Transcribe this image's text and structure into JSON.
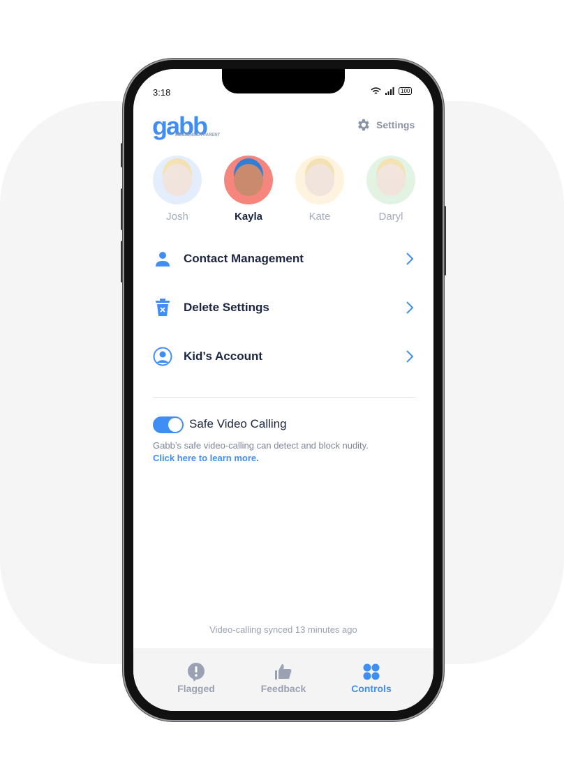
{
  "status": {
    "time": "3:18",
    "battery": "100"
  },
  "header": {
    "logo": "gabb",
    "logo_sub": "MESSENGER PARENT",
    "settings_label": "Settings"
  },
  "kids": [
    {
      "name": "Josh",
      "color": "#dce8fb",
      "selected": false
    },
    {
      "name": "Kayla",
      "color": "#f5857d",
      "selected": true
    },
    {
      "name": "Kate",
      "color": "#fdf0d3",
      "selected": false
    },
    {
      "name": "Daryl",
      "color": "#d9f0dc",
      "selected": false
    }
  ],
  "menu": [
    {
      "label": "Contact Management",
      "icon": "person-icon"
    },
    {
      "label": "Delete Settings",
      "icon": "trash-icon"
    },
    {
      "label": "Kid’s Account",
      "icon": "account-circle-icon"
    }
  ],
  "safe_video": {
    "label": "Safe Video Calling",
    "enabled": true,
    "description": "Gabb’s safe video-calling can detect and block nudity.",
    "link": "Click here to learn more."
  },
  "sync_text": "Video-calling synced 13 minutes ago",
  "tabs": [
    {
      "label": "Flagged",
      "icon": "alert-bubble-icon",
      "active": false
    },
    {
      "label": "Feedback",
      "icon": "thumbs-up-icon",
      "active": false
    },
    {
      "label": "Controls",
      "icon": "grid-dots-icon",
      "active": true
    }
  ],
  "colors": {
    "accent": "#3f8ef5",
    "text": "#1c2541",
    "muted": "#9aa1b2"
  }
}
